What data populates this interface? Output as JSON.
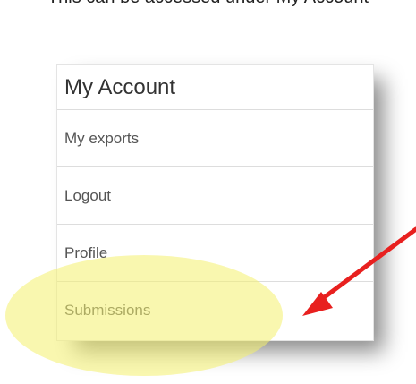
{
  "caption": "This can be accessed under My Account",
  "menu": {
    "title": "My Account",
    "items": [
      {
        "label": "My exports"
      },
      {
        "label": "Logout"
      },
      {
        "label": "Profile"
      },
      {
        "label": "Submissions"
      }
    ]
  },
  "colors": {
    "highlight": "#F4F06E",
    "arrow": "#E8201F"
  }
}
